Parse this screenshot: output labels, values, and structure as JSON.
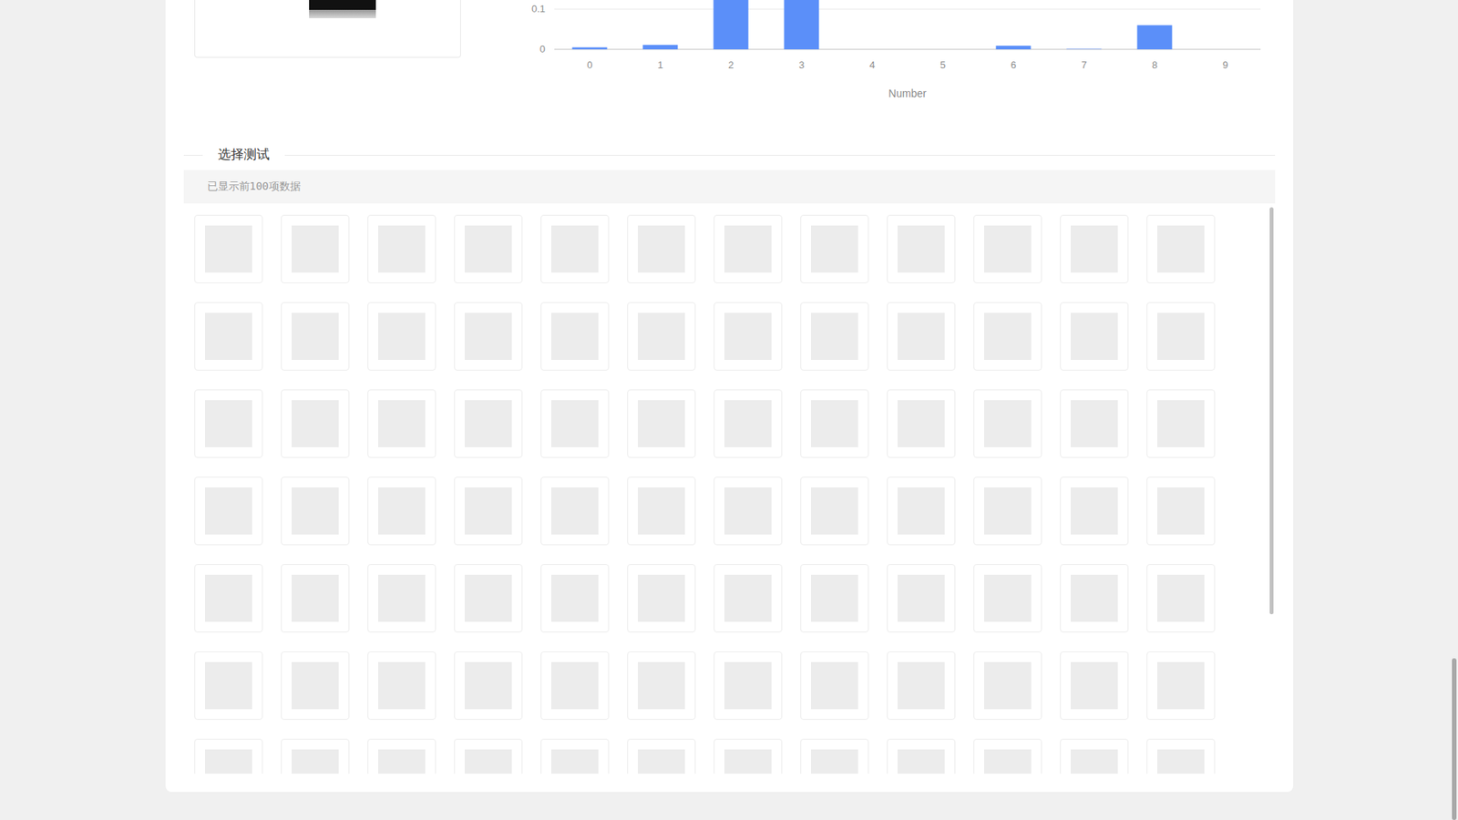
{
  "chart": {
    "y_ticks": [
      "0",
      "0.1"
    ],
    "y_tick_values": [
      0,
      0.1
    ],
    "categories": [
      "0",
      "1",
      "2",
      "3",
      "4",
      "5",
      "6",
      "7",
      "8",
      "9"
    ],
    "values": [
      0.005,
      0.011,
      0.35,
      0.35,
      0,
      0,
      0.009,
      0.001,
      0.06,
      0
    ],
    "x_axis_title": "Number"
  },
  "section": {
    "title": "选择测试"
  },
  "notice": "已显示前100项数据",
  "samples": [
    {
      "selected": false
    },
    {
      "selected": false
    },
    {
      "selected": false
    },
    {
      "selected": false
    },
    {
      "selected": false
    },
    {
      "selected": false
    },
    {
      "selected": false
    },
    {
      "selected": false
    },
    {
      "selected": false
    },
    {
      "selected": false
    },
    {
      "selected": false
    },
    {
      "selected": false
    },
    {
      "selected": false
    },
    {
      "selected": false
    },
    {
      "selected": false
    },
    {
      "selected": false
    },
    {
      "selected": false
    },
    {
      "selected": false
    },
    {
      "selected": false
    },
    {
      "selected": false
    },
    {
      "selected": false
    },
    {
      "selected": false
    },
    {
      "selected": false
    },
    {
      "selected": false
    },
    {
      "selected": false
    },
    {
      "selected": false
    },
    {
      "selected": false
    },
    {
      "selected": false
    },
    {
      "selected": false
    },
    {
      "selected": false
    },
    {
      "selected": false
    },
    {
      "selected": false
    },
    {
      "selected": false
    },
    {
      "selected": false
    },
    {
      "selected": false
    },
    {
      "selected": false
    },
    {
      "selected": false
    },
    {
      "selected": false
    },
    {
      "selected": false
    },
    {
      "selected": false
    },
    {
      "selected": false
    },
    {
      "selected": false
    },
    {
      "selected": false
    },
    {
      "selected": false
    },
    {
      "selected": false
    },
    {
      "selected": false
    },
    {
      "selected": false
    },
    {
      "selected": false
    },
    {
      "selected": false
    },
    {
      "selected": false
    },
    {
      "selected": false
    },
    {
      "selected": false
    },
    {
      "selected": false
    },
    {
      "selected": false
    },
    {
      "selected": false
    },
    {
      "selected": false
    },
    {
      "selected": false
    },
    {
      "selected": false
    },
    {
      "selected": false
    },
    {
      "selected": false
    },
    {
      "selected": false
    },
    {
      "selected": false
    },
    {
      "selected": false
    },
    {
      "selected": false
    },
    {
      "selected": false
    },
    {
      "selected": false
    },
    {
      "selected": false
    },
    {
      "selected": false
    },
    {
      "selected": false
    },
    {
      "selected": false
    },
    {
      "selected": false
    },
    {
      "selected": false
    },
    {
      "selected": false
    },
    {
      "selected": false
    },
    {
      "selected": false
    },
    {
      "selected": false
    },
    {
      "selected": false
    },
    {
      "selected": false
    },
    {
      "selected": false
    },
    {
      "selected": false
    },
    {
      "selected": false
    },
    {
      "selected": false
    },
    {
      "selected": false
    },
    {
      "selected": false
    }
  ]
}
